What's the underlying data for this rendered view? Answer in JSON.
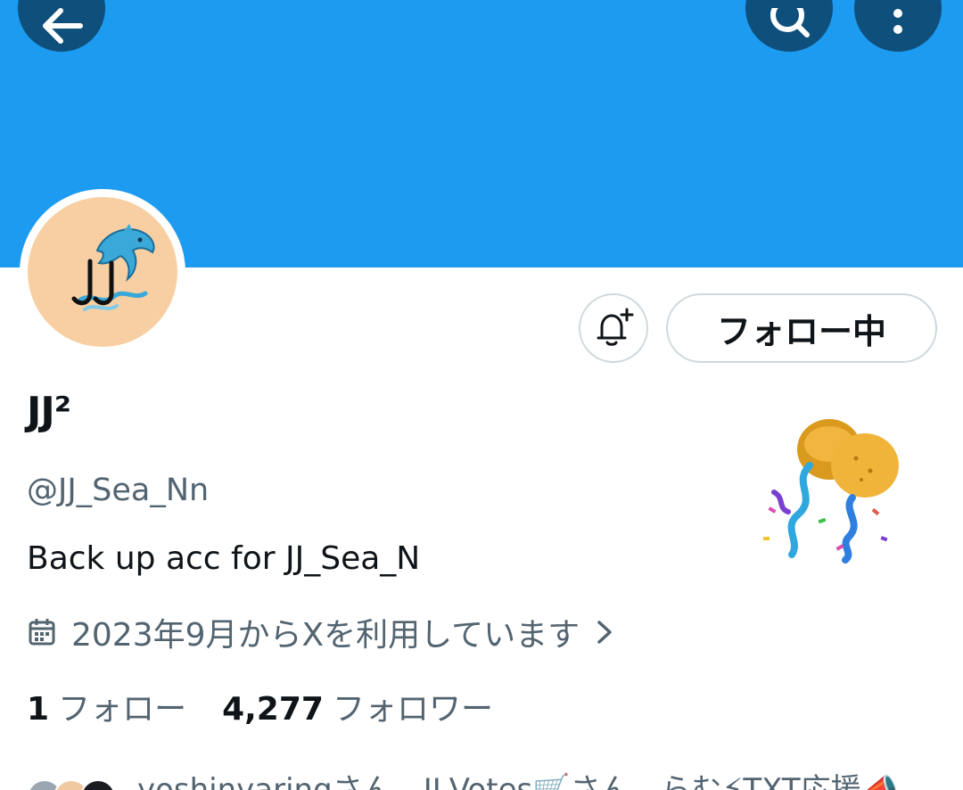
{
  "header": {
    "banner_color": "#1d9bf0",
    "buttons": [
      {
        "icon": "back-arrow-icon"
      },
      {
        "icon": "search-icon"
      },
      {
        "icon": "more-vertical-icon"
      }
    ]
  },
  "profile": {
    "avatar_icon": "dolphin-jj-logo",
    "display_name": "JJ²",
    "handle": "@JJ_Sea_Nn",
    "bio": "Back up acc for JJ_Sea_N",
    "joined": "2023年9月からXを利用しています",
    "follow_button_label": "フォロー中",
    "notification_icon": "bell-plus-icon",
    "celebration_icon": "balloons-confetti-icon"
  },
  "stats": {
    "following_count": "1",
    "following_label": "フォロー",
    "followers_count": "4,277",
    "followers_label": "フォロワー"
  },
  "followed_by": {
    "text": "yoshinyaringさん、JJ-Votes🛒さん、らむ⚡TXT応援📣"
  }
}
